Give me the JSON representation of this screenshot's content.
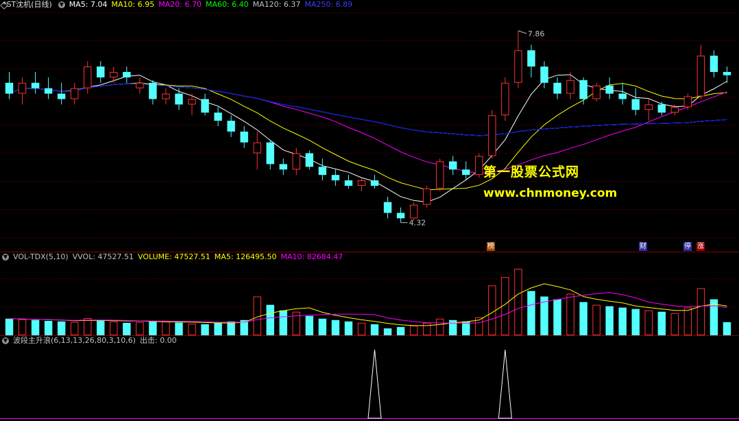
{
  "main_header": {
    "title": "*ST沈机(日线)",
    "ma5": "MA5: 7.04",
    "ma10": "MA10: 6.95",
    "ma20": "MA20: 6.70",
    "ma60": "MA60: 6.40",
    "ma120": "MA120: 6.37",
    "ma250": "MA250: 6.89"
  },
  "vol_header": {
    "name": "VOL-TDX(5,10)",
    "vvol": "VVOL: 47527.51",
    "volume": "VOLUME: 47527.51",
    "ma5": "MA5: 126495.50",
    "ma10": "MA10: 82684.47"
  },
  "ind_header": {
    "name": "波段主升浪(6,13,13,26,80,3,10,6)",
    "out": "出击: 0.00"
  },
  "annotations": {
    "high": "7.86",
    "low": "4.32",
    "watermark_cn": "第一股票公式网",
    "watermark_url": "www.chnmoney.com",
    "tag_bang": "榜",
    "tag_cai": "财",
    "tag_ting": "停",
    "tag_zhang": "涨"
  },
  "colors": {
    "up": "#ff3232",
    "down": "#54ffff",
    "ma5": "#ffffff",
    "ma10": "#ffff00",
    "ma20": "#ff00ff",
    "ma60": "#00ff00",
    "ma120": "#c0c0c0",
    "ma250": "#0000ff",
    "grid": "#800000"
  },
  "chart_data": [
    {
      "type": "candlestick",
      "title": "*ST沈机(日线)",
      "ylim": [
        4.0,
        8.2
      ],
      "ohlc": [
        [
          6.9,
          7.1,
          6.6,
          6.7
        ],
        [
          6.7,
          7.0,
          6.5,
          6.9
        ],
        [
          6.9,
          7.1,
          6.7,
          6.8
        ],
        [
          6.8,
          7.0,
          6.6,
          6.7
        ],
        [
          6.7,
          6.9,
          6.5,
          6.6
        ],
        [
          6.6,
          6.9,
          6.5,
          6.8
        ],
        [
          6.8,
          7.3,
          6.7,
          7.2
        ],
        [
          7.2,
          7.3,
          6.9,
          7.0
        ],
        [
          7.0,
          7.2,
          6.9,
          7.1
        ],
        [
          7.1,
          7.2,
          6.9,
          7.0
        ],
        [
          6.8,
          7.0,
          6.7,
          6.9
        ],
        [
          6.9,
          6.95,
          6.5,
          6.6
        ],
        [
          6.6,
          6.8,
          6.5,
          6.7
        ],
        [
          6.7,
          6.8,
          6.4,
          6.5
        ],
        [
          6.5,
          6.7,
          6.3,
          6.6
        ],
        [
          6.6,
          6.7,
          6.3,
          6.35
        ],
        [
          6.35,
          6.45,
          6.1,
          6.2
        ],
        [
          6.2,
          6.3,
          5.9,
          6.0
        ],
        [
          6.0,
          6.1,
          5.7,
          5.8
        ],
        [
          5.6,
          6.0,
          5.3,
          5.8
        ],
        [
          5.8,
          5.85,
          5.3,
          5.4
        ],
        [
          5.4,
          5.5,
          5.2,
          5.3
        ],
        [
          5.3,
          5.7,
          5.2,
          5.6
        ],
        [
          5.6,
          5.65,
          5.3,
          5.35
        ],
        [
          5.35,
          5.5,
          5.1,
          5.2
        ],
        [
          5.2,
          5.3,
          5.0,
          5.1
        ],
        [
          5.1,
          5.2,
          4.95,
          5.0
        ],
        [
          5.0,
          5.15,
          4.9,
          5.1
        ],
        [
          5.1,
          5.2,
          4.95,
          5.0
        ],
        [
          4.7,
          4.8,
          4.4,
          4.5
        ],
        [
          4.5,
          4.6,
          4.32,
          4.4
        ],
        [
          4.4,
          4.7,
          4.35,
          4.65
        ],
        [
          4.65,
          5.0,
          4.6,
          4.95
        ],
        [
          4.95,
          5.5,
          4.9,
          5.45
        ],
        [
          5.45,
          5.55,
          5.2,
          5.3
        ],
        [
          5.3,
          5.45,
          5.1,
          5.2
        ],
        [
          5.2,
          5.6,
          5.15,
          5.55
        ],
        [
          5.55,
          6.4,
          5.5,
          6.3
        ],
        [
          6.3,
          7.0,
          6.2,
          6.9
        ],
        [
          6.9,
          7.86,
          6.8,
          7.5
        ],
        [
          7.5,
          7.6,
          7.0,
          7.2
        ],
        [
          7.2,
          7.3,
          6.8,
          6.9
        ],
        [
          6.9,
          7.0,
          6.6,
          6.7
        ],
        [
          6.7,
          7.1,
          6.6,
          6.95
        ],
        [
          6.95,
          7.0,
          6.5,
          6.6
        ],
        [
          6.6,
          6.9,
          6.55,
          6.85
        ],
        [
          6.85,
          7.0,
          6.6,
          6.7
        ],
        [
          6.7,
          6.9,
          6.5,
          6.6
        ],
        [
          6.6,
          6.8,
          6.3,
          6.4
        ],
        [
          6.4,
          6.6,
          6.2,
          6.5
        ],
        [
          6.5,
          6.55,
          6.3,
          6.35
        ],
        [
          6.35,
          6.5,
          6.3,
          6.45
        ],
        [
          6.45,
          6.7,
          6.4,
          6.65
        ],
        [
          6.65,
          7.6,
          6.6,
          7.4
        ],
        [
          7.4,
          7.5,
          7.0,
          7.1
        ],
        [
          7.1,
          7.2,
          6.9,
          7.04
        ]
      ]
    },
    {
      "type": "bar",
      "title": "VOL-TDX(5,10)",
      "ylim": [
        0,
        260000
      ],
      "values": [
        60000,
        58000,
        55000,
        52000,
        50000,
        48000,
        62000,
        55000,
        50000,
        45000,
        48000,
        52000,
        50000,
        46000,
        42000,
        40000,
        45000,
        50000,
        55000,
        140000,
        110000,
        90000,
        85000,
        70000,
        60000,
        55000,
        50000,
        45000,
        40000,
        25000,
        30000,
        35000,
        45000,
        60000,
        55000,
        50000,
        65000,
        180000,
        210000,
        240000,
        160000,
        140000,
        130000,
        150000,
        120000,
        110000,
        105000,
        100000,
        95000,
        90000,
        85000,
        80000,
        100000,
        170000,
        130000,
        47527.51
      ]
    },
    {
      "type": "line",
      "title": "波段主升浪(6,13,13,26,80,3,10,6)",
      "ylim": [
        0,
        1
      ],
      "values": [
        0,
        0,
        0,
        0,
        0,
        0,
        0,
        0,
        0,
        0,
        0,
        0,
        0,
        0,
        0,
        0,
        0,
        0,
        0,
        0,
        0,
        0,
        0,
        0,
        0,
        0,
        0,
        0,
        1,
        0,
        0,
        0,
        0,
        0,
        0,
        0,
        0,
        0,
        1,
        0,
        0,
        0,
        0,
        0,
        0,
        0,
        0,
        0,
        0,
        0,
        0,
        0,
        0,
        0,
        0,
        0
      ]
    }
  ]
}
